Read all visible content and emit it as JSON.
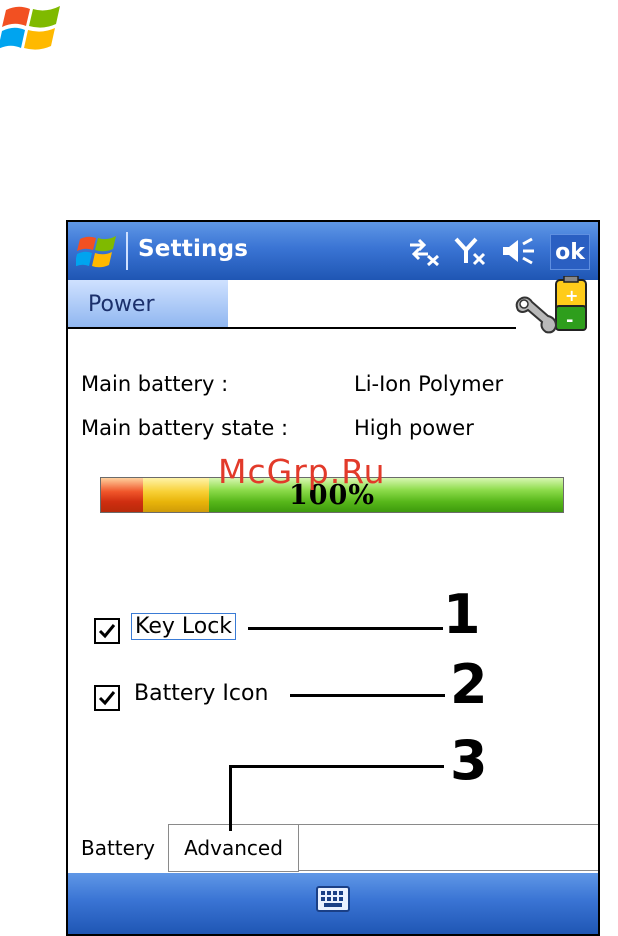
{
  "page": {
    "logo_icon": "windows-flag-icon"
  },
  "device": {
    "titlebar": {
      "title": "Settings",
      "start_icon": "windows-flag-icon",
      "status_icons": [
        "connectivity-icon",
        "signal-off-icon",
        "volume-icon"
      ],
      "ok_label": "ok"
    },
    "header": {
      "title": "Power",
      "icon": "battery-wrench-icon"
    },
    "info": [
      {
        "label": "Main battery :",
        "value": "Li-Ion Polymer"
      },
      {
        "label": "Main battery state :",
        "value": "High power"
      }
    ],
    "battery": {
      "percent_text": "100%",
      "level": 1.0,
      "colors": {
        "low": "#d83a14",
        "mid": "#f2c21e",
        "high": "#5cbc1d"
      }
    },
    "options": [
      {
        "label": "Key Lock",
        "checked": true
      },
      {
        "label": "Battery Icon",
        "checked": true
      }
    ],
    "tabs": [
      {
        "label": "Battery",
        "selected": true
      },
      {
        "label": "Advanced",
        "selected": false
      }
    ],
    "bottom_bar": {
      "icon": "keyboard-icon"
    }
  },
  "watermark": "McGrp.Ru",
  "callouts": [
    "1",
    "2",
    "3"
  ],
  "colors": {
    "titlebar": "#3a74d4",
    "header_tab": "#a9c8f5"
  }
}
